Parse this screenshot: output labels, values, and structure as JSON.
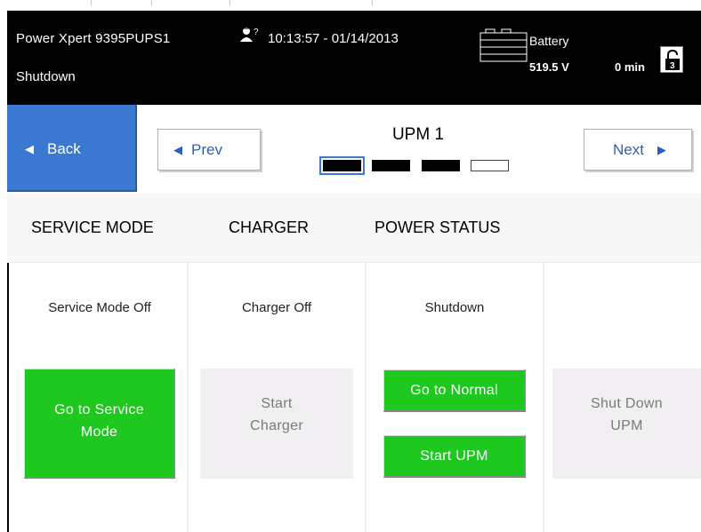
{
  "header": {
    "device_name": "Power Xpert 9395PUPS1",
    "device_status": "Shutdown",
    "user_badge": "?",
    "datetime": "10:13:57 - 01/14/2013",
    "battery_label": "Battery",
    "battery_voltage": "519.5 V",
    "battery_runtime": "0 min",
    "lock_number": "3"
  },
  "nav": {
    "back_label": "Back",
    "prev_label": "Prev",
    "next_label": "Next",
    "title": "UPM 1",
    "page_indicator": {
      "total": 4,
      "current": 1
    }
  },
  "tabs": [
    {
      "label": "SERVICE MODE"
    },
    {
      "label": "CHARGER"
    },
    {
      "label": "POWER STATUS"
    }
  ],
  "columns": [
    {
      "status": "Service Mode Off",
      "buttons": [
        "Go to Service Mode"
      ]
    },
    {
      "status": "Charger Off",
      "buttons": [
        "Start Charger"
      ]
    },
    {
      "status": "Shutdown",
      "buttons": [
        "Go to Normal",
        "Start UPM"
      ]
    },
    {
      "status": "",
      "buttons": [
        "Shut Down UPM"
      ]
    }
  ],
  "button_labels": {
    "service_mode_line1": "Go to Service",
    "service_mode_line2": "Mode",
    "start_charger_line1": "Start",
    "start_charger_line2": "Charger",
    "go_to_normal": "Go to Normal",
    "start_upm": "Start UPM",
    "shut_down_upm_line1": "Shut Down",
    "shut_down_upm_line2": "UPM"
  },
  "colors": {
    "header_bg": "#000000",
    "accent_blue": "#3a78d2",
    "link_blue": "#2d5fb8",
    "action_green": "#1ec81e",
    "disabled_bg": "#f1eff2"
  }
}
